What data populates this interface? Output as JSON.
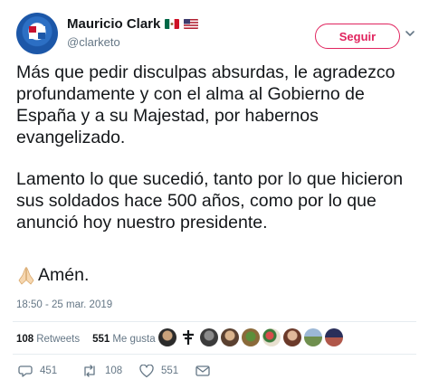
{
  "author": {
    "name": "Mauricio Clark",
    "handle": "@clarketo",
    "flags": [
      "mexico-flag",
      "usa-flag"
    ]
  },
  "follow_label": "Seguir",
  "tweet": {
    "paragraph1": "Más que pedir disculpas absurdas, le agradezco profundamente y con el alma al Gobierno de España y a su Majestad, por habernos evangelizado.",
    "paragraph2": "Lamento lo que sucedió, tanto por lo que hicieron sus soldados hace 500 años, como por lo que anunció hoy nuestro presidente.",
    "closing": "Amén.",
    "closing_emoji": "praying-hands-icon"
  },
  "timestamp": "18:50 - 25 mar. 2019",
  "stats": {
    "retweets_count": "108",
    "retweets_label": "Retweets",
    "likes_count": "551",
    "likes_label": "Me gusta"
  },
  "actions": {
    "reply_count": "451",
    "retweet_count": "108",
    "like_count": "551"
  },
  "colors": {
    "accent": "#e0245e",
    "muted": "#657786",
    "text": "#14171a"
  }
}
